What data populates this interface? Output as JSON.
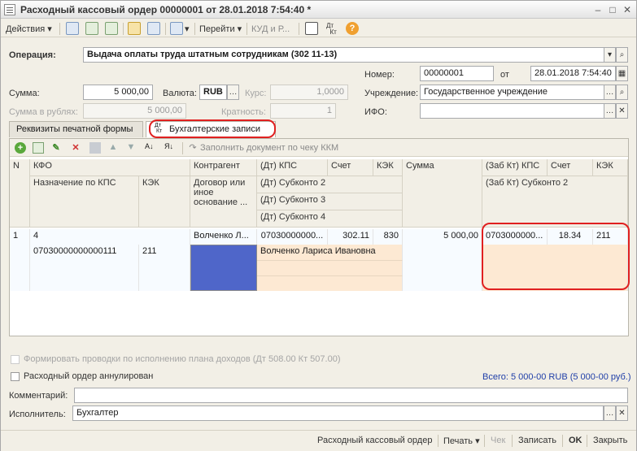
{
  "window": {
    "title": "Расходный кассовый ордер 00000001 от 28.01.2018 7:54:40 *"
  },
  "toolbar": {
    "actions": "Действия",
    "goto": "Перейти",
    "kud": "КУД и Р...",
    "dtkt": "Дт Кт"
  },
  "operation": {
    "label": "Операция:",
    "value": "Выдача оплаты труда штатным сотрудникам (302 11-13)"
  },
  "number": {
    "label": "Номер:",
    "value": "00000001",
    "from_label": "от",
    "date": "28.01.2018  7:54:40"
  },
  "sum": {
    "label": "Сумма:",
    "value": "5 000,00",
    "currency_label": "Валюта:",
    "currency": "RUB",
    "rate_label": "Курс:",
    "rate": "1,0000"
  },
  "sum_rub": {
    "label": "Сумма в рублях:",
    "value": "5 000,00",
    "mult_label": "Кратность:",
    "mult": "1"
  },
  "institution": {
    "label": "Учреждение:",
    "value": "Государственное учреждение"
  },
  "ifo": {
    "label": "ИФО:",
    "value": ""
  },
  "tabs": [
    {
      "label": "Реквизиты печатной формы"
    },
    {
      "label": "Бухгалтерские записи"
    }
  ],
  "grid_toolbar": {
    "fill_label": "Заполнить документ по чеку ККМ"
  },
  "grid": {
    "headers": {
      "n": "N",
      "kfo": "КФО",
      "counterparty": "Контрагент",
      "dt_kps": "(Дт) КПС",
      "account": "Счет",
      "kek": "КЭК",
      "sum": "Сумма",
      "kt_kps": "(Заб Кт) КПС",
      "kt_account": "Счет",
      "kt_kek": "КЭК",
      "purpose": "Назначение по КПС",
      "kek2": "КЭК",
      "contract": "Договор или иное основание ...",
      "dt_sub2": "(Дт) Субконто 2",
      "dt_sub3": "(Дт) Субконто 3",
      "dt_sub4": "(Дт) Субконто 4",
      "kt_sub2": "(Заб Кт) Субконто 2"
    },
    "row": {
      "n": "1",
      "kfo": "4",
      "counterparty": "Волченко Л...",
      "dt_kps": "07030000000...",
      "account": "302.11",
      "kek": "830",
      "sum": "5 000,00",
      "kt_kps": "0703000000...",
      "kt_account": "18.34",
      "kt_kek": "211",
      "purpose": "07030000000000111",
      "kek2": "211",
      "sub2": "Волченко Лариса Ивановна"
    }
  },
  "form_postings": {
    "label": "Формировать проводки по исполнению плана доходов (Дт 508.00 Кт 507.00)"
  },
  "cancelled": {
    "label": "Расходный ордер аннулирован"
  },
  "total": {
    "label": "Всего: 5 000-00 RUB (5 000-00 руб.)"
  },
  "comment": {
    "label": "Комментарий:",
    "value": ""
  },
  "executor": {
    "label": "Исполнитель:",
    "value": "Бухгалтер"
  },
  "bottom": {
    "print_form": "Расходный кассовый ордер",
    "print": "Печать",
    "check": "Чек",
    "save": "Записать",
    "ok": "OK",
    "close": "Закрыть"
  },
  "colors": {
    "accent": "#1f3ea8",
    "highlight_red": "#e02020",
    "blue_cell": "#4f66c9",
    "peach": "#fde9d3"
  }
}
